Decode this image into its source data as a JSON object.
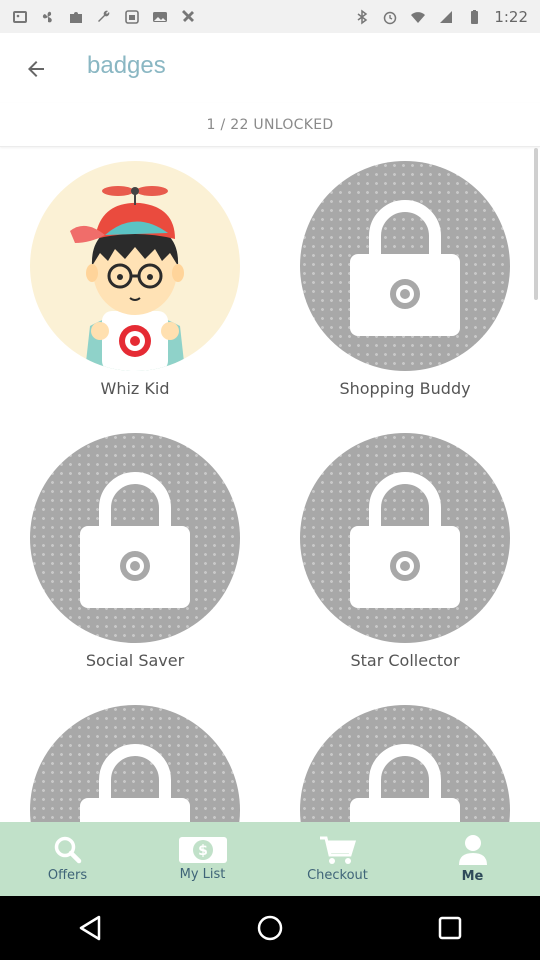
{
  "status_bar": {
    "time": "1:22",
    "left_icons": [
      "gallery-icon",
      "fan-icon",
      "puzzle-icon",
      "wrench-icon",
      "sim-icon",
      "photo-icon",
      "tools-icon"
    ],
    "right_icons": [
      "bluetooth-icon",
      "alarm-icon",
      "wifi-icon",
      "signal-icon",
      "battery-icon"
    ]
  },
  "header": {
    "title": "badges"
  },
  "summary": {
    "unlocked_text": "1 / 22 UNLOCKED"
  },
  "badges": [
    {
      "name": "Whiz Kid",
      "locked": false
    },
    {
      "name": "Shopping Buddy",
      "locked": true
    },
    {
      "name": "Social Saver",
      "locked": true
    },
    {
      "name": "Star Collector",
      "locked": true
    },
    {
      "name": "",
      "locked": true
    },
    {
      "name": "",
      "locked": true
    }
  ],
  "tabs": [
    {
      "label": "Offers",
      "icon": "search-icon",
      "active": false
    },
    {
      "label": "My List",
      "icon": "dollar-icon",
      "active": false
    },
    {
      "label": "Checkout",
      "icon": "cart-icon",
      "active": false
    },
    {
      "label": "Me",
      "icon": "person-icon",
      "active": true
    }
  ],
  "colors": {
    "title": "#8ab7c3",
    "tab_bar": "#c1e1c9",
    "tab_label": "#3f6478",
    "lock_badge": "#a8a8a8"
  }
}
